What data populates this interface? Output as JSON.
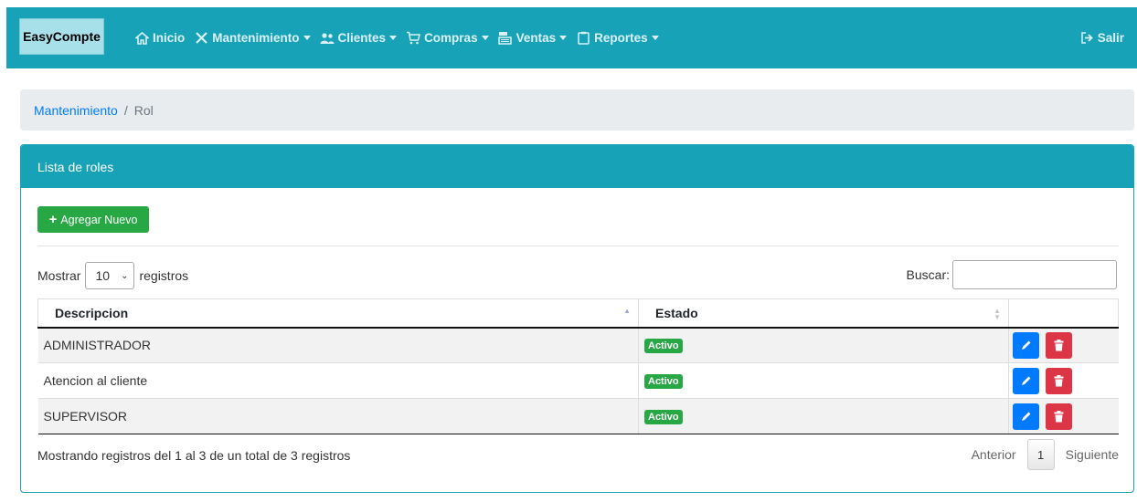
{
  "navbar": {
    "brand": "EasyCompte",
    "items": [
      {
        "label": "Inicio",
        "icon": "home-icon",
        "dropdown": false
      },
      {
        "label": "Mantenimiento",
        "icon": "tools-icon",
        "dropdown": true
      },
      {
        "label": "Clientes",
        "icon": "users-icon",
        "dropdown": true
      },
      {
        "label": "Compras",
        "icon": "cart-icon",
        "dropdown": true
      },
      {
        "label": "Ventas",
        "icon": "cash-register-icon",
        "dropdown": true
      },
      {
        "label": "Reportes",
        "icon": "clipboard-icon",
        "dropdown": true
      }
    ],
    "logout": "Salir",
    "color": "#17a2b8"
  },
  "breadcrumb": {
    "parent": "Mantenimiento",
    "separator": "/",
    "current": "Rol"
  },
  "card": {
    "title": "Lista de roles",
    "add_button": "Agregar Nuevo"
  },
  "table_controls": {
    "show_label": "Mostrar",
    "page_size": "10",
    "records_label": "registros",
    "search_label": "Buscar:",
    "search_value": ""
  },
  "table": {
    "columns": [
      "Descripcion",
      "Estado",
      ""
    ],
    "rows": [
      {
        "descripcion": "ADMINISTRADOR",
        "estado": "Activo"
      },
      {
        "descripcion": "Atencion al cliente",
        "estado": "Activo"
      },
      {
        "descripcion": "SUPERVISOR",
        "estado": "Activo"
      }
    ]
  },
  "footer": {
    "info": "Mostrando registros del 1 al 3 de un total de 3 registros",
    "prev": "Anterior",
    "page": "1",
    "next": "Siguiente"
  }
}
